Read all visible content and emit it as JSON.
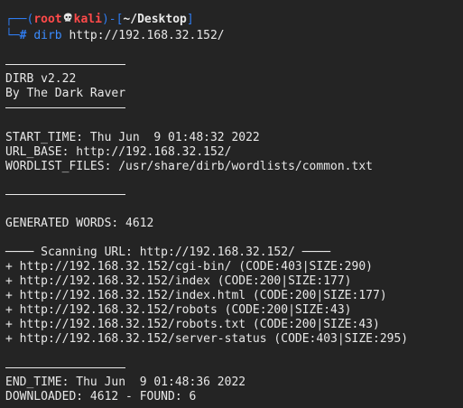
{
  "prompt": {
    "frame_top": "┌──(",
    "user": "root",
    "skull": "💀",
    "host": "kali",
    "separator": ")-[",
    "path": "~/Desktop",
    "frame_end": "]",
    "frame_bottom": "└─",
    "hash": "#",
    "command_name": "dirb",
    "command_args": " http://192.168.32.152/"
  },
  "header": {
    "version": "DIRB v2.22",
    "author": "By The Dark Raver"
  },
  "info": {
    "start_time": "START_TIME: Thu Jun  9 01:48:32 2022",
    "url_base": "URL_BASE: http://192.168.32.152/",
    "wordlist": "WORDLIST_FILES: /usr/share/dirb/wordlists/common.txt"
  },
  "generated": "GENERATED WORDS: 4612",
  "scan_header": "──── Scanning URL: http://192.168.32.152/ ────",
  "results": [
    "+ http://192.168.32.152/cgi-bin/ (CODE:403|SIZE:290)",
    "+ http://192.168.32.152/index (CODE:200|SIZE:177)",
    "+ http://192.168.32.152/index.html (CODE:200|SIZE:177)",
    "+ http://192.168.32.152/robots (CODE:200|SIZE:43)",
    "+ http://192.168.32.152/robots.txt (CODE:200|SIZE:43)",
    "+ http://192.168.32.152/server-status (CODE:403|SIZE:295)"
  ],
  "footer": {
    "end_time": "END_TIME: Thu Jun  9 01:48:36 2022",
    "downloaded": "DOWNLOADED: 4612 - FOUND: 6"
  },
  "colors": {
    "background": "#242424",
    "text": "#e8e8e8",
    "prompt_frame": "#2f7cf0",
    "prompt_user": "#ff4a4a",
    "command": "#3b8cff"
  }
}
